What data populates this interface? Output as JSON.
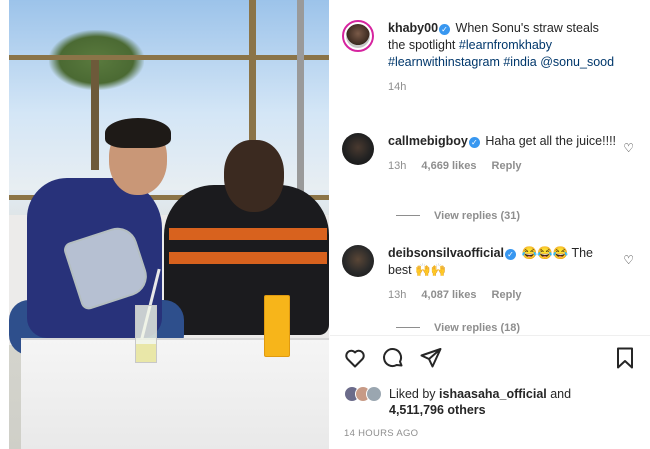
{
  "post": {
    "caption_user": "khaby00",
    "caption_text": "When Sonu's straw steals the spotlight",
    "hashtags": [
      "#learnfromkhaby",
      "#learnwithinstagram",
      "#india"
    ],
    "mention": "@sonu_sood",
    "caption_time": "14h"
  },
  "comments": [
    {
      "user": "callmebigboy",
      "text": "Haha get all the juice!!!!",
      "time": "13h",
      "likes": "4,669 likes",
      "reply": "Reply",
      "view_replies": "View replies (31)"
    },
    {
      "user": "deibsonsilvaofficial",
      "text_before": "😂😂😂 The best",
      "emoji_after": "🙌🙌",
      "time": "13h",
      "likes": "4,087 likes",
      "reply": "Reply",
      "view_replies": "View replies (18)"
    }
  ],
  "actions": {
    "like_icon": "heart-icon",
    "comment_icon": "comment-bubble-icon",
    "share_icon": "paper-plane-icon",
    "save_icon": "bookmark-icon"
  },
  "likes": {
    "prefix": "Liked by",
    "user": "ishaasaha_official",
    "connector": "and",
    "others": "4,511,796 others"
  },
  "timestamp": "14 HOURS AGO",
  "colors": {
    "link": "#00376b",
    "verified": "#3897f0",
    "muted": "#8e8e8e",
    "story_ring": "#d6249f"
  }
}
